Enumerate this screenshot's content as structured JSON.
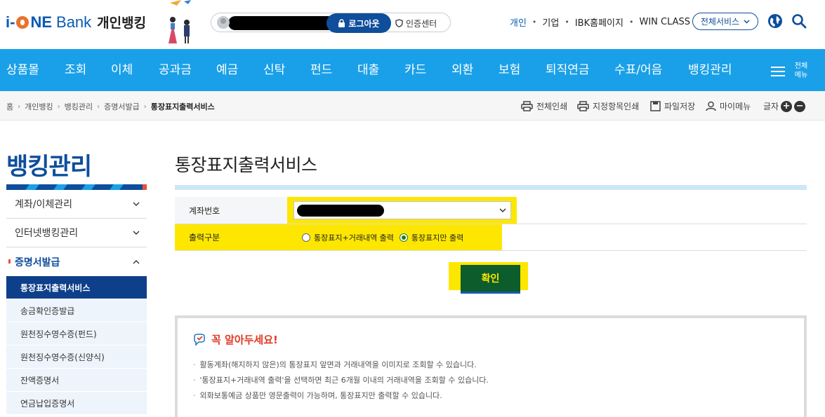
{
  "header": {
    "logo": {
      "i": "i",
      "dash": "-",
      "ne": "NE",
      "bank": "Bank",
      "personal": "개인뱅킹"
    },
    "logout_label": "로그아웃",
    "cert_label": "인증센터",
    "topnav": [
      "개인",
      "기업",
      "IBK홈페이지",
      "WIN CLASS"
    ],
    "all_services_label": "전체서비스"
  },
  "gnb": {
    "items": [
      "상품몰",
      "조회",
      "이체",
      "공과금",
      "예금",
      "신탁",
      "펀드",
      "대출",
      "카드",
      "외환",
      "보험",
      "퇴직연금",
      "수표/어음",
      "뱅킹관리"
    ],
    "all_menu_label": [
      "전체",
      "메뉴"
    ]
  },
  "location": {
    "breadcrumb": [
      "홈",
      "개인뱅킹",
      "뱅킹관리",
      "증명서발급",
      "통장표지출력서비스"
    ],
    "utils": [
      "전체인쇄",
      "지정항목인쇄",
      "파일저장",
      "마이메뉴"
    ],
    "font_label": "글자",
    "font_plus": "+",
    "font_minus": "−"
  },
  "lnb": {
    "title": "뱅킹관리",
    "items": [
      "계좌/이체관리",
      "인터넷뱅킹관리",
      "증명서발급"
    ],
    "subitems": [
      "통장표지출력서비스",
      "송금확인증발급",
      "원천징수영수증(펀드)",
      "원천징수영수증(신양식)",
      "잔액증명서",
      "연금납입증명서"
    ]
  },
  "content": {
    "page_title": "통장표지출력서비스",
    "account_label": "계좌번호",
    "output_label": "출력구분",
    "output_options": [
      "통장표지+거래내역 출력",
      "통장표지만 출력"
    ],
    "selected_option": "통장표지만 출력",
    "confirm_label": "확인",
    "notice_title": "꼭 알아두세요!",
    "notices": [
      "활동계좌(해지하지 않은)의 통장표지 앞면과 거래내역을 이미지로 조회할 수 있습니다.",
      "'통장표지+거래내역 출력'을 선택하면 최근 6개월 이내의 거래내역을 조회할 수 있습니다.",
      "외화보통예금 상품만 영문출력이 가능하며, 통장표지만 출력할 수 있습니다."
    ]
  },
  "colors": {
    "brand": "#0e4e9b",
    "gnb": "#1aa0e8",
    "highlight": "#fde700",
    "confirm": "#0c5c2c",
    "notice": "#e03a24"
  }
}
